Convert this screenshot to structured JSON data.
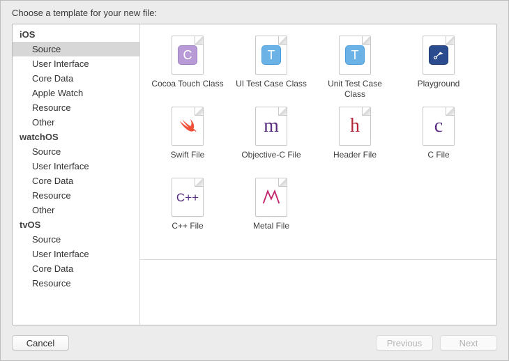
{
  "header": {
    "title": "Choose a template for your new file:"
  },
  "sidebar": {
    "groups": [
      {
        "name": "iOS",
        "items": [
          {
            "label": "Source",
            "selected": true
          },
          {
            "label": "User Interface"
          },
          {
            "label": "Core Data"
          },
          {
            "label": "Apple Watch"
          },
          {
            "label": "Resource"
          },
          {
            "label": "Other"
          }
        ]
      },
      {
        "name": "watchOS",
        "items": [
          {
            "label": "Source"
          },
          {
            "label": "User Interface"
          },
          {
            "label": "Core Data"
          },
          {
            "label": "Resource"
          },
          {
            "label": "Other"
          }
        ]
      },
      {
        "name": "tvOS",
        "items": [
          {
            "label": "Source"
          },
          {
            "label": "User Interface"
          },
          {
            "label": "Core Data"
          },
          {
            "label": "Resource"
          }
        ]
      }
    ]
  },
  "templates": [
    {
      "id": "cocoa-touch-class",
      "label": "Cocoa Touch Class",
      "glyph": "C",
      "style": "purple-box"
    },
    {
      "id": "ui-test-case-class",
      "label": "UI Test Case Class",
      "glyph": "T",
      "style": "blue-box"
    },
    {
      "id": "unit-test-case-class",
      "label": "Unit Test Case Class",
      "glyph": "T",
      "style": "blue-box"
    },
    {
      "id": "playground",
      "label": "Playground",
      "glyph": "",
      "style": "dark-box"
    },
    {
      "id": "swift-file",
      "label": "Swift File",
      "glyph": "swift",
      "style": "swift"
    },
    {
      "id": "objective-c-file",
      "label": "Objective-C File",
      "glyph": "m",
      "style": "text",
      "color": "#5a2d82"
    },
    {
      "id": "header-file",
      "label": "Header File",
      "glyph": "h",
      "style": "text",
      "color": "#b4273b"
    },
    {
      "id": "c-file",
      "label": "C File",
      "glyph": "c",
      "style": "text",
      "color": "#5a2d82"
    },
    {
      "id": "cpp-file",
      "label": "C++ File",
      "glyph": "C++",
      "style": "text-small",
      "color": "#5a2d82"
    },
    {
      "id": "metal-file",
      "label": "Metal File",
      "glyph": "metal",
      "style": "metal"
    }
  ],
  "footer": {
    "cancel": "Cancel",
    "previous": "Previous",
    "next": "Next",
    "previous_enabled": false,
    "next_enabled": false
  }
}
